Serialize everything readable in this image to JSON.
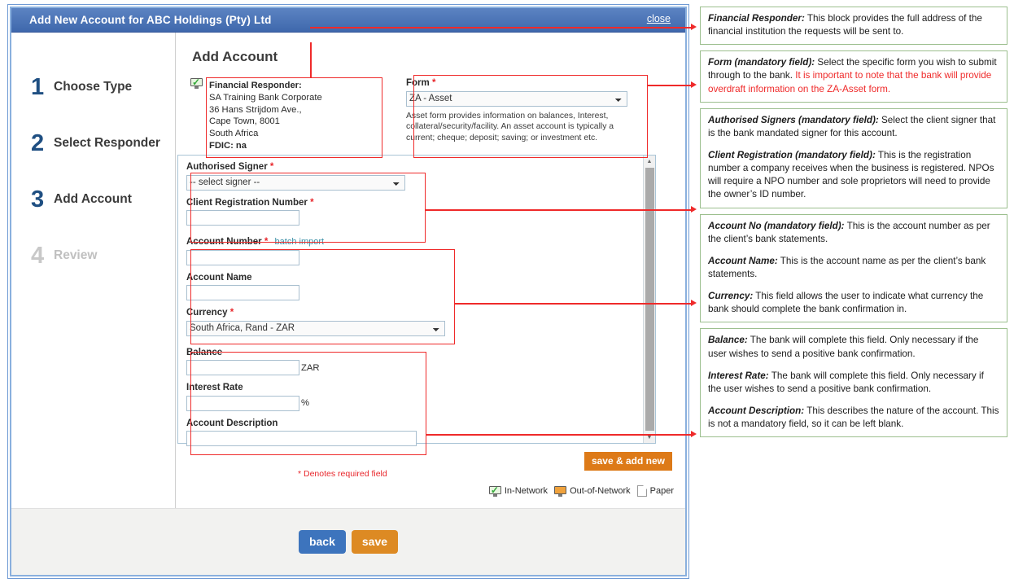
{
  "window": {
    "title": "Add New Account for ABC Holdings (Pty) Ltd",
    "close_label": "close"
  },
  "steps": [
    {
      "num": "1",
      "label": "Choose Type"
    },
    {
      "num": "2",
      "label": "Select Responder"
    },
    {
      "num": "3",
      "label": "Add Account"
    },
    {
      "num": "4",
      "label": "Review"
    }
  ],
  "form": {
    "pane_title": "Add Account",
    "responder": {
      "heading": "Financial Responder:",
      "line1": "SA Training Bank Corporate",
      "line2": "36 Hans Strijdom Ave.,",
      "line3": "Cape Town, 8001",
      "line4": "South Africa",
      "line5": "FDIC: na",
      "icon": "in-network-monitor-icon"
    },
    "form_field": {
      "label": "Form",
      "required_mark": "*",
      "value": "ZA - Asset",
      "help": "Asset form provides information on balances, Interest, collateral/security/facility. An asset account is typically a current; cheque; deposit; saving; or investment etc."
    },
    "authorised_signer": {
      "label": "Authorised Signer",
      "required_mark": "*",
      "value": "-- select signer --"
    },
    "client_registration": {
      "label": "Client Registration Number",
      "required_mark": "*",
      "value": ""
    },
    "account_number": {
      "label": "Account Number",
      "required_mark": "*",
      "link": "batch import",
      "value": ""
    },
    "account_name": {
      "label": "Account Name",
      "value": ""
    },
    "currency": {
      "label": "Currency",
      "required_mark": "*",
      "value": "South Africa, Rand - ZAR"
    },
    "balance": {
      "label": "Balance",
      "value": "",
      "suffix": "ZAR"
    },
    "interest_rate": {
      "label": "Interest Rate",
      "value": "",
      "suffix": "%"
    },
    "account_description": {
      "label": "Account Description",
      "value": ""
    },
    "required_note": "* Denotes required field",
    "save_add_new": "save & add new"
  },
  "legend": [
    {
      "label": "In-Network",
      "icon": "in-network-monitor-icon"
    },
    {
      "label": "Out-of-Network",
      "icon": "out-of-network-monitor-icon"
    },
    {
      "label": "Paper",
      "icon": "paper-page-icon"
    }
  ],
  "footer": {
    "back": "back",
    "save": "save"
  },
  "notes": [
    {
      "lead": "Financial Responder:",
      "text": " This block provides the full address of the financial institution the requests will be sent to."
    },
    {
      "lead": "Form (mandatory field):",
      "text": " Select the specific form you wish to submit through to the bank. ",
      "red": "It is important to note that the bank will provide overdraft information on the ZA-Asset form."
    },
    {
      "lead": "Authorised Signers (mandatory field):",
      "text": " Select the client signer that is the bank mandated signer for this account.",
      "lead2": "Client Registration (mandatory field):",
      "text2": " This is the registration number a company receives when the business is registered. NPOs will require a NPO number and sole proprietors will need to provide the owner’s ID number."
    },
    {
      "lead": "Account No (mandatory field):",
      "text": " This is the account number as per the client’s bank statements.",
      "lead2": "Account Name:",
      "text2": " This is the account name as per the client’s bank statements.",
      "lead3": "Currency:",
      "text3": " This field allows the user to indicate what currency the bank should complete the bank confirmation in."
    },
    {
      "lead": "Balance:",
      "text": " The bank will complete this field. Only necessary if the user wishes to send a positive bank confirmation.",
      "lead2": "Interest Rate:",
      "text2": " The bank will complete this field. Only necessary if the user wishes to send a positive bank confirmation.",
      "lead3": "Account Description:",
      "text3": " This describes the nature of the account. This is not a mandatory field, so it can be left blank."
    }
  ],
  "colors": {
    "titlebar": "#4a74b8",
    "accent_orange": "#dd8a23",
    "callout_red": "#ef2a2a",
    "note_border": "#9cbf8e",
    "step_number": "#1f4f82"
  }
}
